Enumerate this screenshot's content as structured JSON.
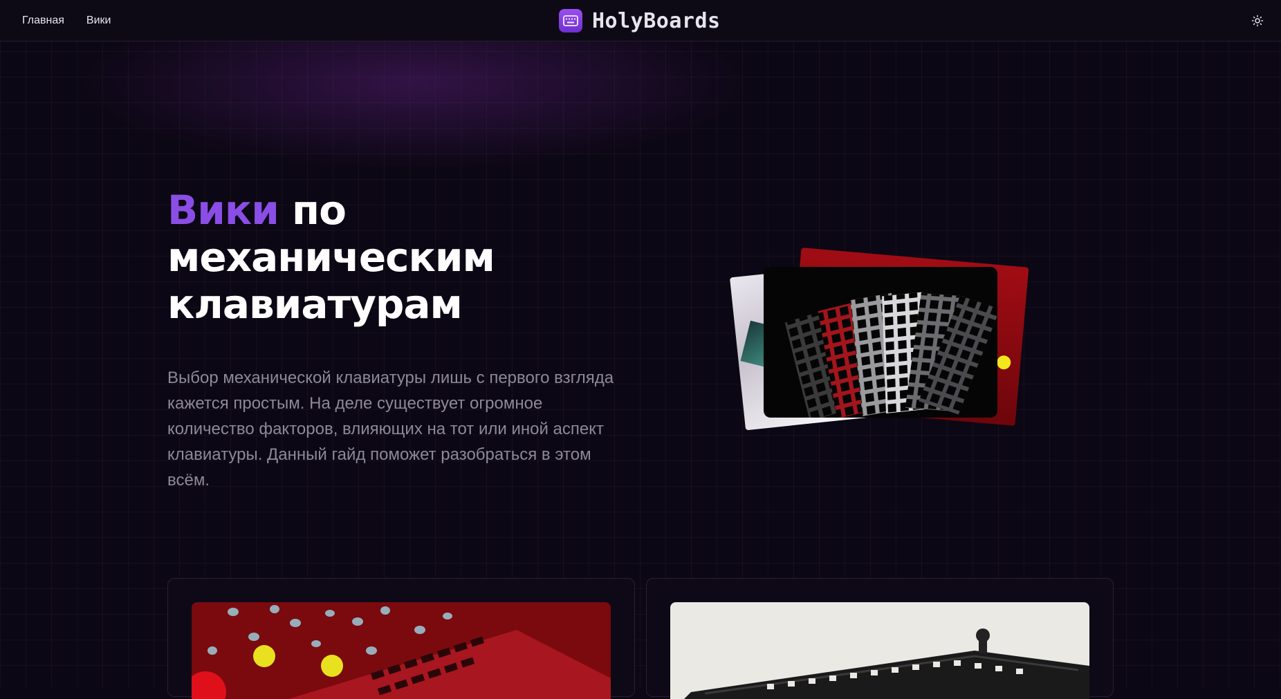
{
  "header": {
    "nav": [
      {
        "label": "Главная"
      },
      {
        "label": "Вики"
      }
    ],
    "brand": "HolyBoards",
    "logo_icon": "keyboard-icon",
    "theme_icon": "sun-icon"
  },
  "hero": {
    "title_accent": "Вики",
    "title_rest": " по механическим клавиатурам",
    "description": "Выбор механической клавиатуры лишь с первого взгляда кажется простым. На деле существует огромное количество факторов, влияющих на тот или иной аспект клавиатуры. Данный гайд поможет разобраться в этом всём."
  },
  "colors": {
    "accent": "#8a4ee6",
    "background": "#0c0714",
    "text_muted": "#8e8999"
  }
}
